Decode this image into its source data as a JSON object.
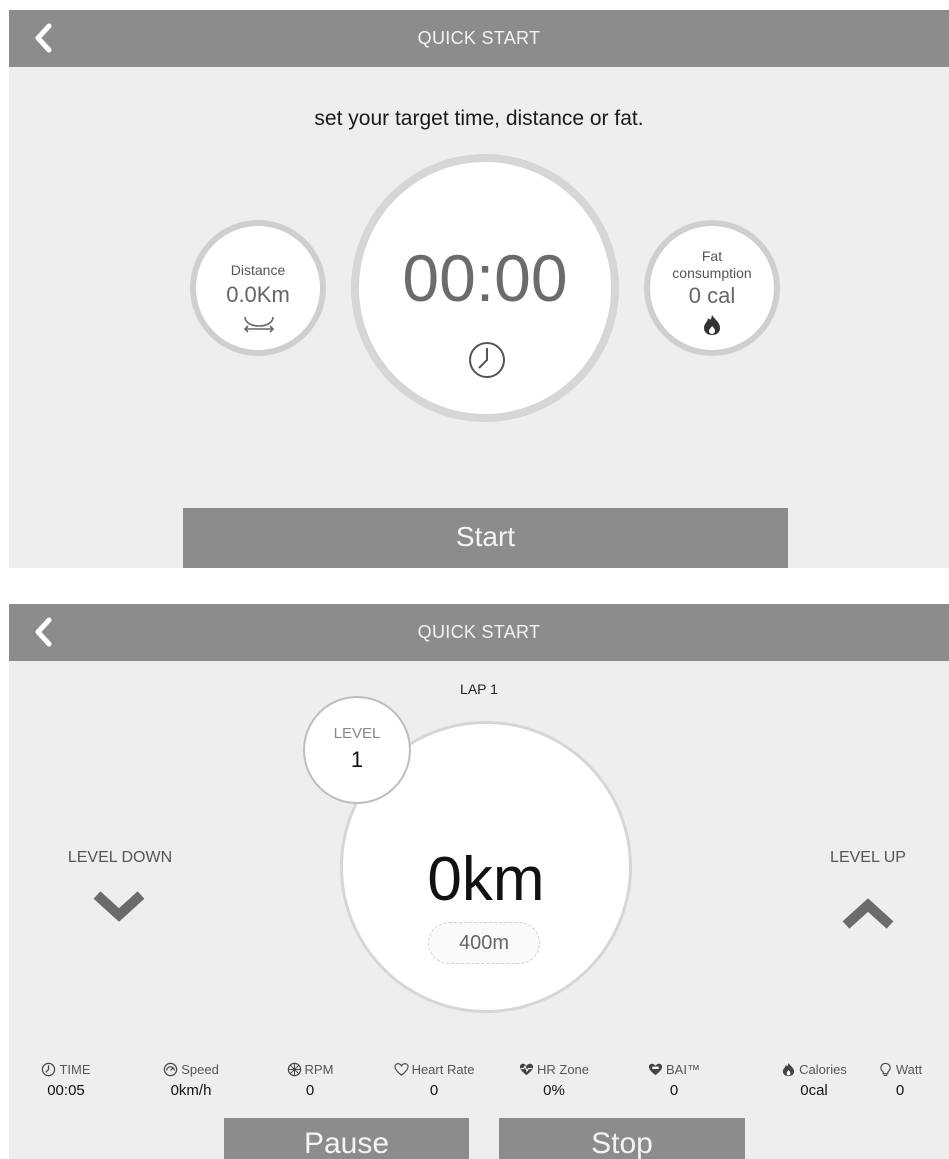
{
  "screen1": {
    "header": {
      "title": "QUICK START"
    },
    "instruction": "set your target time, distance or fat.",
    "distance": {
      "label": "Distance",
      "value": "0.0Km"
    },
    "time": {
      "value": "00:00"
    },
    "fat": {
      "label_line1": "Fat",
      "label_line2": "consumption",
      "value": "0 cal"
    },
    "start_label": "Start"
  },
  "screen2": {
    "header": {
      "title": "QUICK START"
    },
    "lap": "LAP 1",
    "level": {
      "label": "LEVEL",
      "value": "1"
    },
    "distance_value": "0km",
    "lap_length": "400m",
    "level_down_label": "LEVEL DOWN",
    "level_up_label": "LEVEL UP",
    "stats": [
      {
        "icon": "clock-icon",
        "label": "TIME",
        "value": "00:05"
      },
      {
        "icon": "speed-icon",
        "label": "Speed",
        "value": "0km/h"
      },
      {
        "icon": "rpm-icon",
        "label": "RPM",
        "value": "0"
      },
      {
        "icon": "heart-icon",
        "label": "Heart Rate",
        "value": "0"
      },
      {
        "icon": "hr-zone-icon",
        "label": "HR Zone",
        "value": "0%"
      },
      {
        "icon": "bai-icon",
        "label": "BAI™",
        "value": "0"
      },
      {
        "icon": "flame-icon",
        "label": "Calories",
        "value": "0cal"
      },
      {
        "icon": "bulb-icon",
        "label": "Watt",
        "value": "0"
      }
    ],
    "pause_label": "Pause",
    "stop_label": "Stop"
  },
  "colors": {
    "header": "#8c8c8c",
    "background": "#eeeeee",
    "ring": "#d6d6d6",
    "accent_text": "#6b6b6b"
  }
}
